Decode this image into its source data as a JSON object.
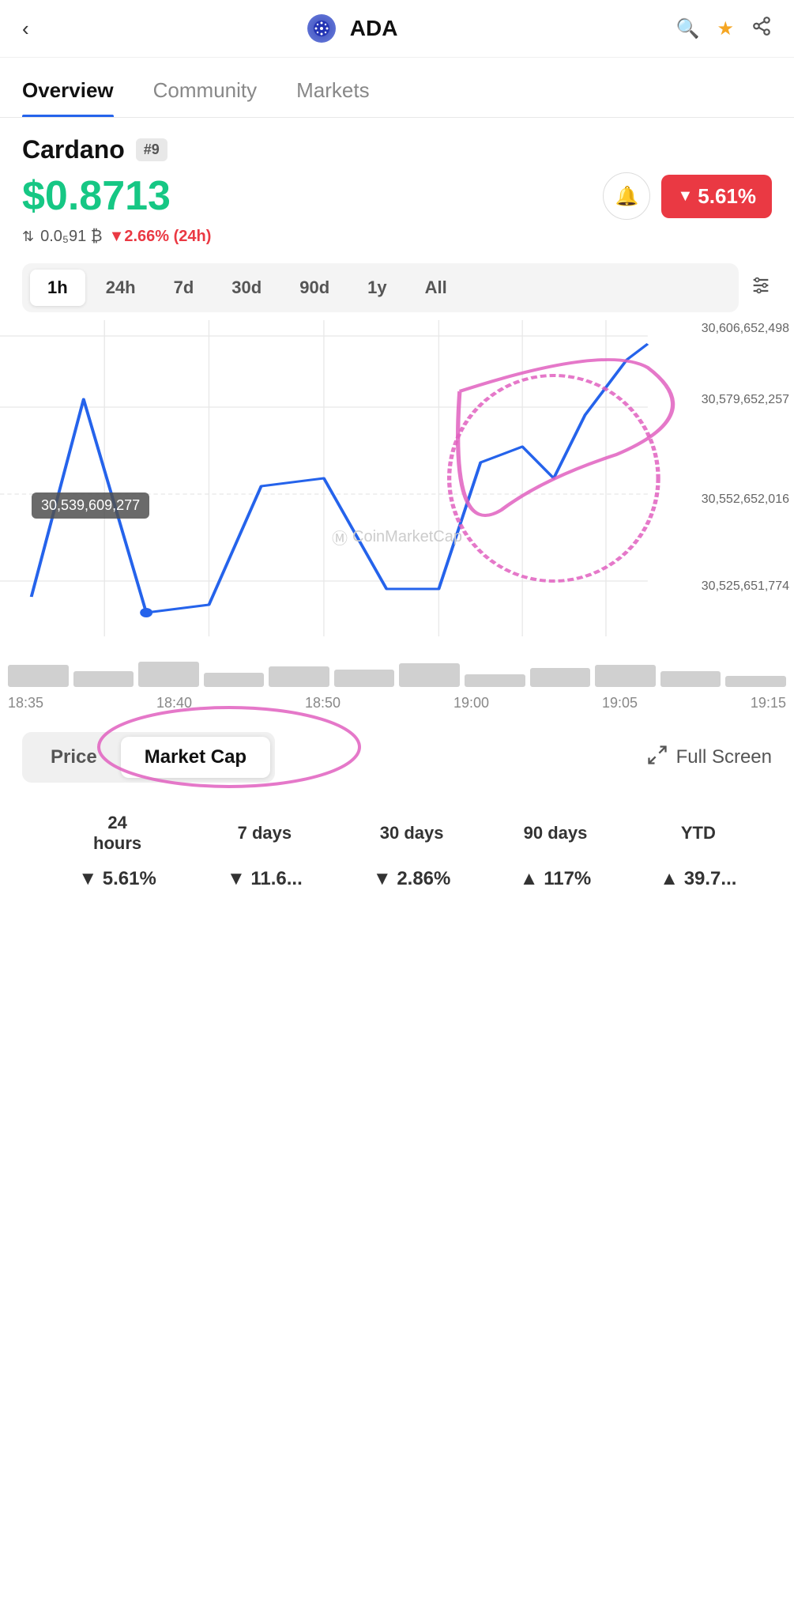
{
  "topBar": {
    "coinSymbol": "ADA",
    "coinIconLabel": "ADA"
  },
  "tabs": [
    {
      "id": "overview",
      "label": "Overview",
      "active": true
    },
    {
      "id": "community",
      "label": "Community",
      "active": false
    },
    {
      "id": "markets",
      "label": "Markets",
      "active": false
    }
  ],
  "coinInfo": {
    "name": "Cardano",
    "rank": "#9",
    "price": "$0.8713",
    "changePercent": "▼ 5.61%",
    "btcPrice": "0.0₅91",
    "btcChange": "▼2.66% (24h)"
  },
  "timeFilters": [
    "1h",
    "24h",
    "7d",
    "30d",
    "90d",
    "1y",
    "All"
  ],
  "activeTimeFilter": "1h",
  "chart": {
    "yLabels": [
      "30,606,652,498",
      "30,579,652,257",
      "30,552,652,016",
      "30,525,651,774"
    ],
    "xLabels": [
      "18:35",
      "18:40",
      "18:50",
      "19:00",
      "19:05",
      "19:15"
    ],
    "tooltip": "30,539,609,277",
    "watermark": "CoinMarketCap"
  },
  "chartToggle": {
    "options": [
      {
        "id": "price",
        "label": "Price"
      },
      {
        "id": "marketcap",
        "label": "Market Cap",
        "active": true
      }
    ],
    "fullscreenLabel": "Full Screen"
  },
  "performance": {
    "headers": [
      "24\nhours",
      "7 days",
      "30 days",
      "90 days",
      "YTD"
    ],
    "row1Label": "",
    "values": [
      {
        "label": "▼ 5.61%",
        "type": "neg"
      },
      {
        "label": "▼ 11.6...",
        "type": "neg"
      },
      {
        "label": "▼ 2.86%",
        "type": "neg"
      },
      {
        "label": "▲ 117%",
        "type": "pos"
      },
      {
        "label": "▲ 39.7...",
        "type": "pos"
      }
    ]
  }
}
